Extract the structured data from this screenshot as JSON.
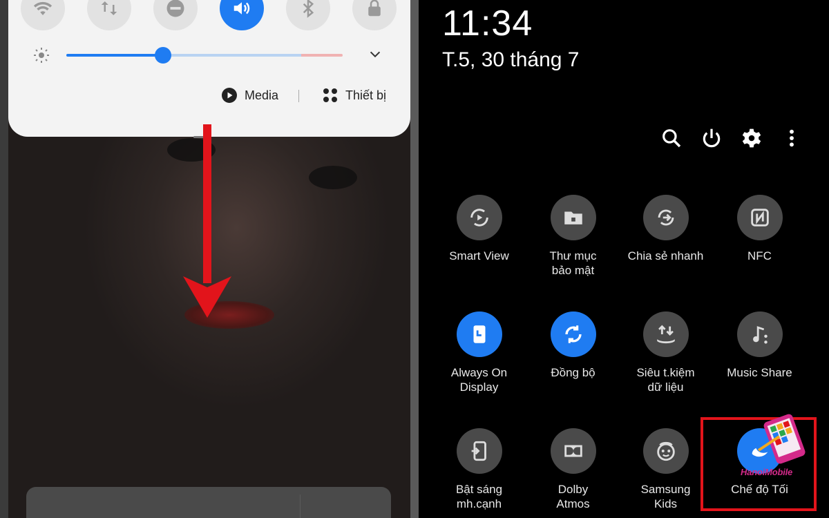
{
  "left_panel": {
    "quick_tiles": [
      {
        "icon": "wifi-icon",
        "active": false
      },
      {
        "icon": "data-transfer-icon",
        "active": false
      },
      {
        "icon": "do-not-disturb-icon",
        "active": false
      },
      {
        "icon": "sound-icon",
        "active": true
      },
      {
        "icon": "bluetooth-icon",
        "active": false
      },
      {
        "icon": "lock-icon",
        "active": false
      }
    ],
    "brightness_level": 0.35,
    "media_label": "Media",
    "devices_label": "Thiết bị"
  },
  "right_panel": {
    "time": "11:34",
    "date": "T.5, 30 tháng 7",
    "tiles": [
      {
        "label": "Smart View",
        "icon": "smart-view-icon",
        "active": false
      },
      {
        "label": "Thư mục bảo mật",
        "icon": "secure-folder-icon",
        "active": false
      },
      {
        "label": "Chia sẻ nhanh",
        "icon": "quick-share-icon",
        "active": false
      },
      {
        "label": "NFC",
        "icon": "nfc-icon",
        "active": false
      },
      {
        "label": "Always On Display",
        "icon": "always-on-display-icon",
        "active": true
      },
      {
        "label": "Đồng bộ",
        "icon": "sync-icon",
        "active": true
      },
      {
        "label": "Siêu t.kiệm dữ liệu",
        "icon": "data-saver-icon",
        "active": false
      },
      {
        "label": "Music Share",
        "icon": "music-share-icon",
        "active": false
      },
      {
        "label": "Bật sáng mh.cạnh",
        "icon": "edge-lighting-icon",
        "active": false
      },
      {
        "label": "Dolby Atmos",
        "icon": "dolby-icon",
        "active": false
      },
      {
        "label": "Samsung Kids",
        "icon": "kids-icon",
        "active": false
      },
      {
        "label": "Chế độ Tối",
        "icon": "dark-mode-icon",
        "active": true
      }
    ]
  },
  "watermark": "HanoiMobile",
  "colors": {
    "accent": "#1f7cf2",
    "highlight": "#e2141b",
    "arrow": "#e2141b"
  }
}
